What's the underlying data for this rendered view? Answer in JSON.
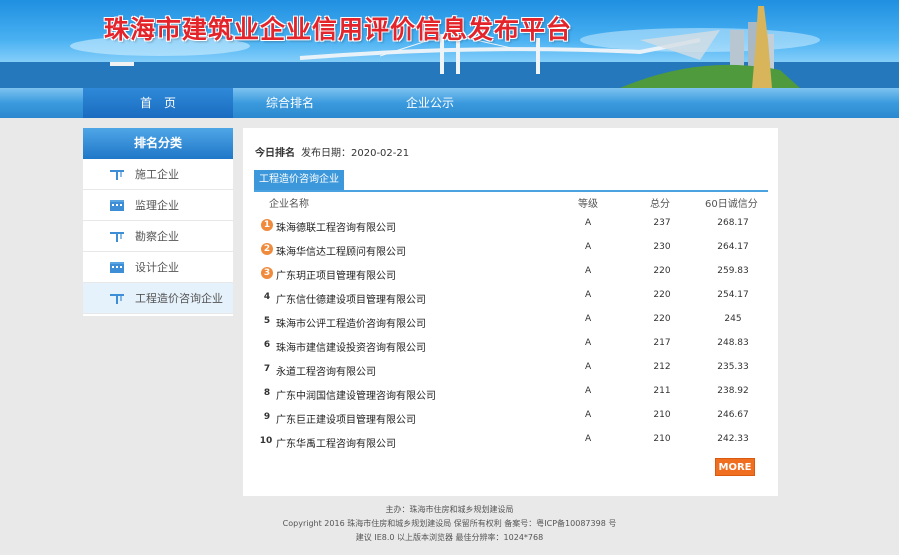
{
  "banner": {
    "title": "珠海市建筑业企业信用评价信息发布平台"
  },
  "nav": {
    "items": [
      {
        "label": "首　页"
      },
      {
        "label": "综合排名"
      },
      {
        "label": "企业公示"
      }
    ]
  },
  "sidebar": {
    "heading": "排名分类",
    "items": [
      {
        "label": "施工企业",
        "icon": "crane-icon"
      },
      {
        "label": "监理企业",
        "icon": "building-icon"
      },
      {
        "label": "勘察企业",
        "icon": "crane-icon"
      },
      {
        "label": "设计企业",
        "icon": "building-icon"
      },
      {
        "label": "工程造价咨询企业",
        "icon": "crane-icon"
      }
    ]
  },
  "main": {
    "today_label": "今日排名",
    "date_label": "发布日期：2020-02-21",
    "tab_label": "工程造价咨询企业",
    "columns": {
      "name": "企业名称",
      "grade": "等级",
      "score": "总分",
      "credit": "60日诚信分"
    },
    "rows": [
      {
        "rank": "1",
        "name": "珠海德联工程咨询有限公司",
        "grade": "A",
        "score": "237",
        "credit": "268.17"
      },
      {
        "rank": "2",
        "name": "珠海华信达工程顾问有限公司",
        "grade": "A",
        "score": "230",
        "credit": "264.17"
      },
      {
        "rank": "3",
        "name": "广东玥正项目管理有限公司",
        "grade": "A",
        "score": "220",
        "credit": "259.83"
      },
      {
        "rank": "4",
        "name": "广东信仕德建设项目管理有限公司",
        "grade": "A",
        "score": "220",
        "credit": "254.17"
      },
      {
        "rank": "5",
        "name": "珠海市公评工程造价咨询有限公司",
        "grade": "A",
        "score": "220",
        "credit": "245"
      },
      {
        "rank": "6",
        "name": "珠海市建信建设投资咨询有限公司",
        "grade": "A",
        "score": "217",
        "credit": "248.83"
      },
      {
        "rank": "7",
        "name": "永道工程咨询有限公司",
        "grade": "A",
        "score": "212",
        "credit": "235.33"
      },
      {
        "rank": "8",
        "name": "广东中润国信建设管理咨询有限公司",
        "grade": "A",
        "score": "211",
        "credit": "238.92"
      },
      {
        "rank": "9",
        "name": "广东巨正建设项目管理有限公司",
        "grade": "A",
        "score": "210",
        "credit": "246.67"
      },
      {
        "rank": "10",
        "name": "广东华禹工程咨询有限公司",
        "grade": "A",
        "score": "210",
        "credit": "242.33"
      }
    ],
    "more_label": "MORE"
  },
  "footer": {
    "line1": "主办：珠海市住房和城乡规划建设局",
    "line2": "Copyright 2016 珠海市住房和城乡规划建设局 保留所有权利 备案号：粤ICP备10087398 号",
    "line3": "建议 IE8.0 以上版本浏览器 最佳分辨率：1024*768"
  },
  "colors": {
    "accent": "#3d98db",
    "more": "#ef6e1f",
    "medal": "#f08a3c",
    "title": "#e3242b"
  }
}
